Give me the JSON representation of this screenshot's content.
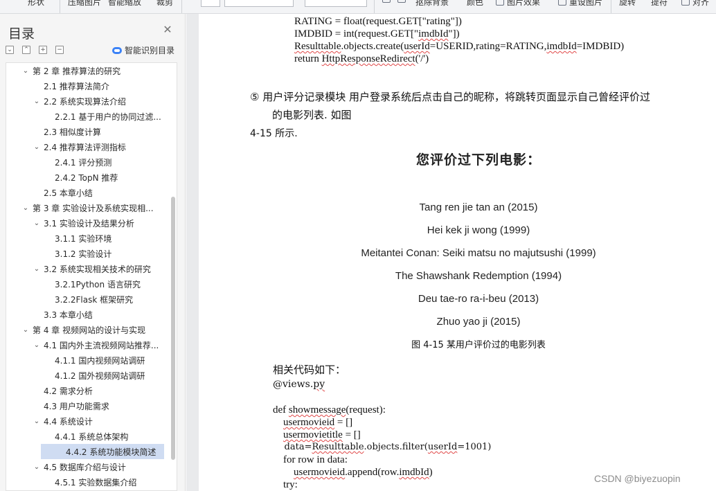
{
  "toolbar": {
    "items": [
      "形状",
      "压缩图片",
      "智能缩放",
      "裁剪",
      "抠除背景",
      "颜色",
      "图片效果",
      "重设图片",
      "旋转",
      "提符",
      "对齐"
    ]
  },
  "sidebar": {
    "title": "目录",
    "smart_toc_label": "智能识别目录",
    "items": [
      {
        "label": "第 2 章 推荐算法的研究",
        "level": 1,
        "expanded": true
      },
      {
        "label": "2.1 推荐算法简介",
        "level": 2
      },
      {
        "label": "2.2 系统实现算法介绍",
        "level": 2,
        "expanded": true
      },
      {
        "label": "2.2.1 基于用户的协同过滤...",
        "level": 3
      },
      {
        "label": "2.3 相似度计算",
        "level": 2
      },
      {
        "label": "2.4 推荐算法评测指标",
        "level": 2,
        "expanded": true
      },
      {
        "label": "2.4.1 评分预测",
        "level": 3
      },
      {
        "label": "2.4.2 TopN 推荐",
        "level": 3
      },
      {
        "label": "2.5 本章小结",
        "level": 2
      },
      {
        "label": "第 3 章 实验设计及系统实现相...",
        "level": 1,
        "expanded": true
      },
      {
        "label": "3.1 实验设计及结果分析",
        "level": 2,
        "expanded": true
      },
      {
        "label": "3.1.1 实验环境",
        "level": 3
      },
      {
        "label": "3.1.2 实验设计",
        "level": 3
      },
      {
        "label": "3.2 系统实现相关技术的研究",
        "level": 2,
        "expanded": true
      },
      {
        "label": "3.2.1Python 语言研究",
        "level": 3
      },
      {
        "label": "3.2.2Flask 框架研究",
        "level": 3
      },
      {
        "label": "3.3 本章小结",
        "level": 2
      },
      {
        "label": "第 4 章 视频网站的设计与实现",
        "level": 1,
        "expanded": true
      },
      {
        "label": "4.1 国内外主流视频网站推荐...",
        "level": 2,
        "expanded": true
      },
      {
        "label": "4.1.1 国内视频网站调研",
        "level": 3
      },
      {
        "label": "4.1.2 国外视频网站调研",
        "level": 3
      },
      {
        "label": "4.2 需求分析",
        "level": 2
      },
      {
        "label": "4.3 用户功能需求",
        "level": 2
      },
      {
        "label": "4.4 系统设计",
        "level": 2,
        "expanded": true
      },
      {
        "label": "4.4.1 系统总体架构",
        "level": 3
      },
      {
        "label": "4.4.2 系统功能模块简述",
        "level": 3,
        "selected": true
      },
      {
        "label": "4.5 数据库介绍与设计",
        "level": 2,
        "expanded": true
      },
      {
        "label": "4.5.1 实验数据集介绍",
        "level": 3
      }
    ]
  },
  "document": {
    "code_top": [
      "RATING = float(request.GET[\"rating\"])",
      "IMDBID = int(request.GET[\"imdbId\"])",
      "Resulttable.objects.create(userId=USERID,rating=RATING,imdbId=IMDBID)",
      "return HttpResponseRedirect('/')"
    ],
    "para_line1": "⑤  用户评分记录模块 用户登录系统后点击自己的昵称，将跳转页面显示自己曾经评价过",
    "para_line2": "的电影列表. 如图",
    "para_line3": "4-15 所示.",
    "figure_title": "您评价过下列电影：",
    "movies": [
      "Tang ren jie tan an (2015)",
      "Hei kek ji wong (1999)",
      "Meitantei Conan: Seiki matsu no majutsushi (1999)",
      "The Shawshank Redemption (1994)",
      "Deu tae-ro ra-i-beu (2013)",
      "Zhuo yao ji (2015)"
    ],
    "caption": "图  4-15 某用户评价过的电影列表",
    "code_intro": "相关代码如下：",
    "code_file": "@views.py",
    "code_bottom": [
      "def showmessage(request):",
      "    usermovieid = []",
      "    usermovietitle = []",
      "    data=Resulttable.objects.filter(userId=1001)",
      "    for row in data:",
      "        usermovieid.append(row.imdbId)",
      "    try:"
    ]
  },
  "watermark": "CSDN @biyezuopin"
}
